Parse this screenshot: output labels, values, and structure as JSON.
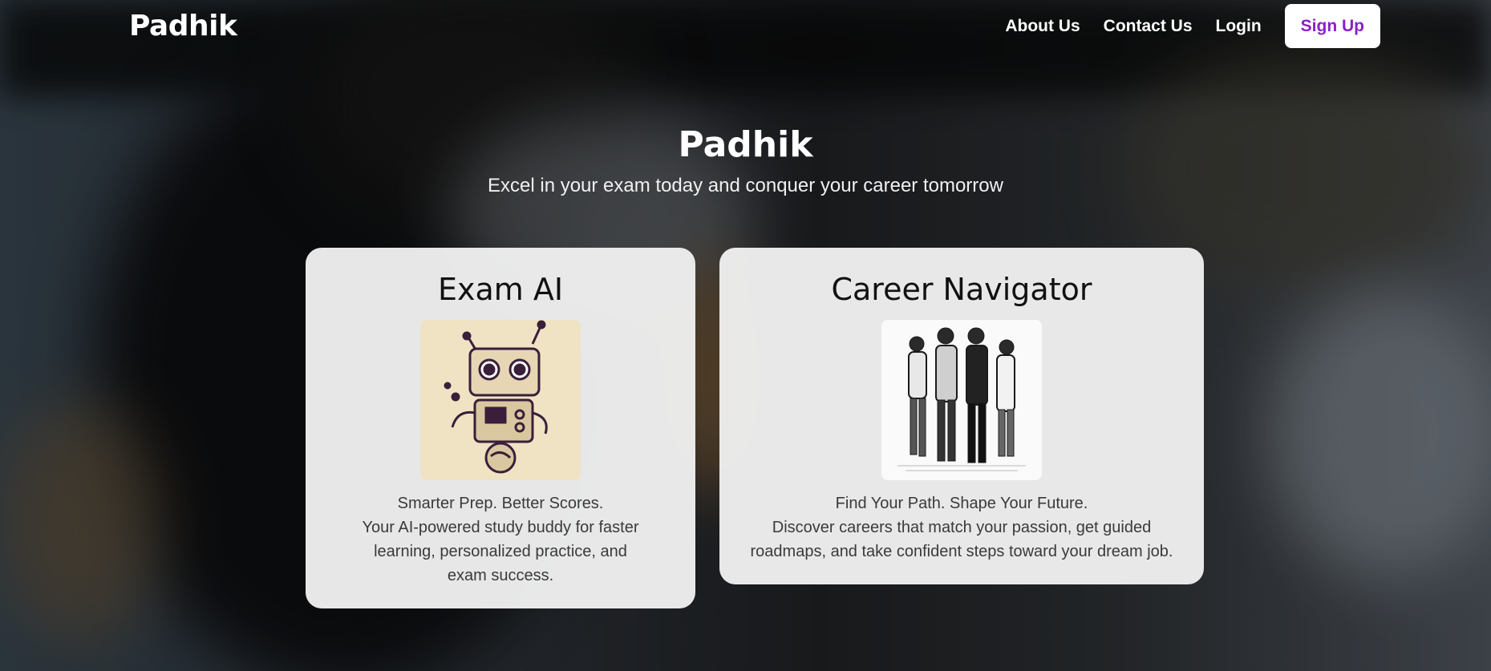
{
  "nav": {
    "brand": "Padhik",
    "links": [
      "About Us",
      "Contact Us",
      "Login"
    ],
    "signup": "Sign Up"
  },
  "hero": {
    "title": "Padhik",
    "subtitle": "Excel in your exam today and conquer your career tomorrow"
  },
  "cards": [
    {
      "title": "Exam AI",
      "tagline": "Smarter Prep. Better Scores.",
      "description": "Your AI-powered study buddy for faster learning, personalized practice, and exam success.",
      "image": "robot-sketch"
    },
    {
      "title": "Career Navigator",
      "tagline": "Find Your Path. Shape Your Future.",
      "description": "Discover careers that match your passion, get guided roadmaps, and take confident steps toward your dream job.",
      "image": "people-walking-sketch"
    }
  ],
  "colors": {
    "accent": "#8a1fc9",
    "card_bg": "#f0f0f0"
  }
}
